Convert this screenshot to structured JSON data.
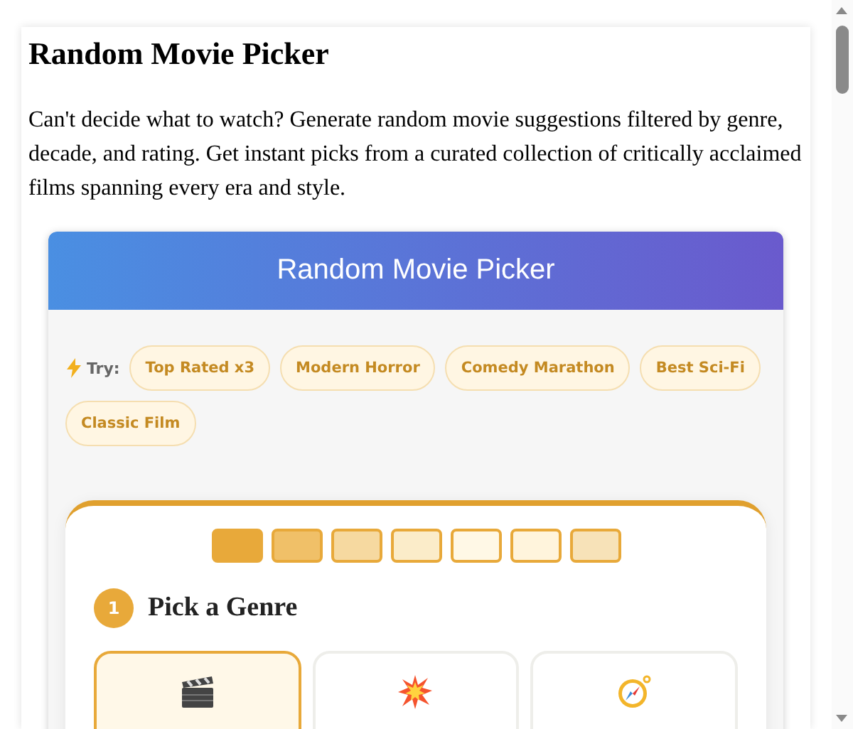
{
  "page": {
    "title": "Random Movie Picker",
    "intro": "Can't decide what to watch? Generate random movie suggestions filtered by genre, decade, and rating. Get instant picks from a curated collection of critically acclaimed films spanning every era and style."
  },
  "widget": {
    "title": "Random Movie Picker",
    "try_label": "Try:",
    "presets": [
      "Top Rated x3",
      "Modern Horror",
      "Comedy Marathon",
      "Best Sci-Fi",
      "Classic Film"
    ],
    "steps": [
      {
        "color": "#e8a93a"
      },
      {
        "color": "#f0c068"
      },
      {
        "color": "#f6d9a0"
      },
      {
        "color": "#fbecc9"
      },
      {
        "color": "#fff8e6"
      },
      {
        "color": "#fff4dc"
      },
      {
        "color": "#f7e2b8"
      }
    ],
    "section": {
      "number": "1",
      "title": "Pick a Genre"
    },
    "genres": [
      {
        "kind": "clapper",
        "selected": true
      },
      {
        "kind": "explosion",
        "selected": false
      },
      {
        "kind": "compass",
        "selected": false
      }
    ]
  }
}
